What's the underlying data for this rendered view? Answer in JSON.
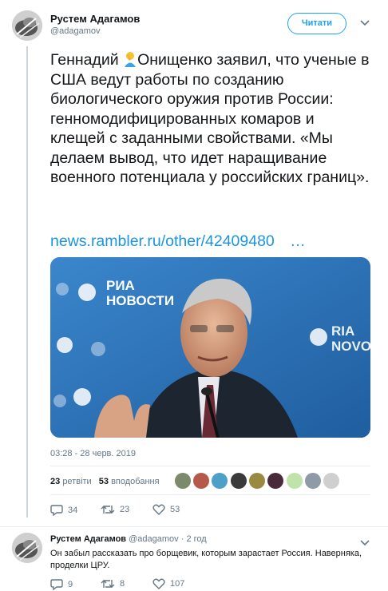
{
  "tweet": {
    "author_name": "Рустем Адагамов",
    "author_handle": "@adagamov",
    "follow_label": "Читати",
    "text_before_emoji": "Геннадий ",
    "text_after_emoji": "Онищенко заявил, что ученые в США ведут работы по созданию биологического оружия против России: генномодифицированных комаров и клещей с заданными свойствами. «Мы делаем вывод, что идет наращивание военного потенциала у российских границ».",
    "link_text": "news.rambler.ru/other/42409480",
    "link_ellipsis": "…",
    "photo_brand_main": "РИА НОВОСТИ",
    "photo_brand_right": "RIA NOVO",
    "timestamp": "03:28 - 28 черв. 2019",
    "retweets_count": "23",
    "retweets_label": "ретвіти",
    "likes_count": "53",
    "likes_label": "вподобання",
    "actions": {
      "replies": "34",
      "retweets": "23",
      "likes": "53"
    }
  },
  "reply": {
    "author_name": "Рустем Адагамов",
    "author_handle": "@adagamov",
    "time": "· 2 год",
    "text": "Он забыл рассказать про борщевик, которым зарастает Россия. Наверняка, проделки ЦРУ.",
    "actions": {
      "replies": "9",
      "retweets": "8",
      "likes": "107"
    }
  },
  "colors": {
    "accent": "#1da1f2",
    "link": "#1b95e0",
    "muted": "#657786",
    "photo_bg": "#2a6fb6"
  }
}
